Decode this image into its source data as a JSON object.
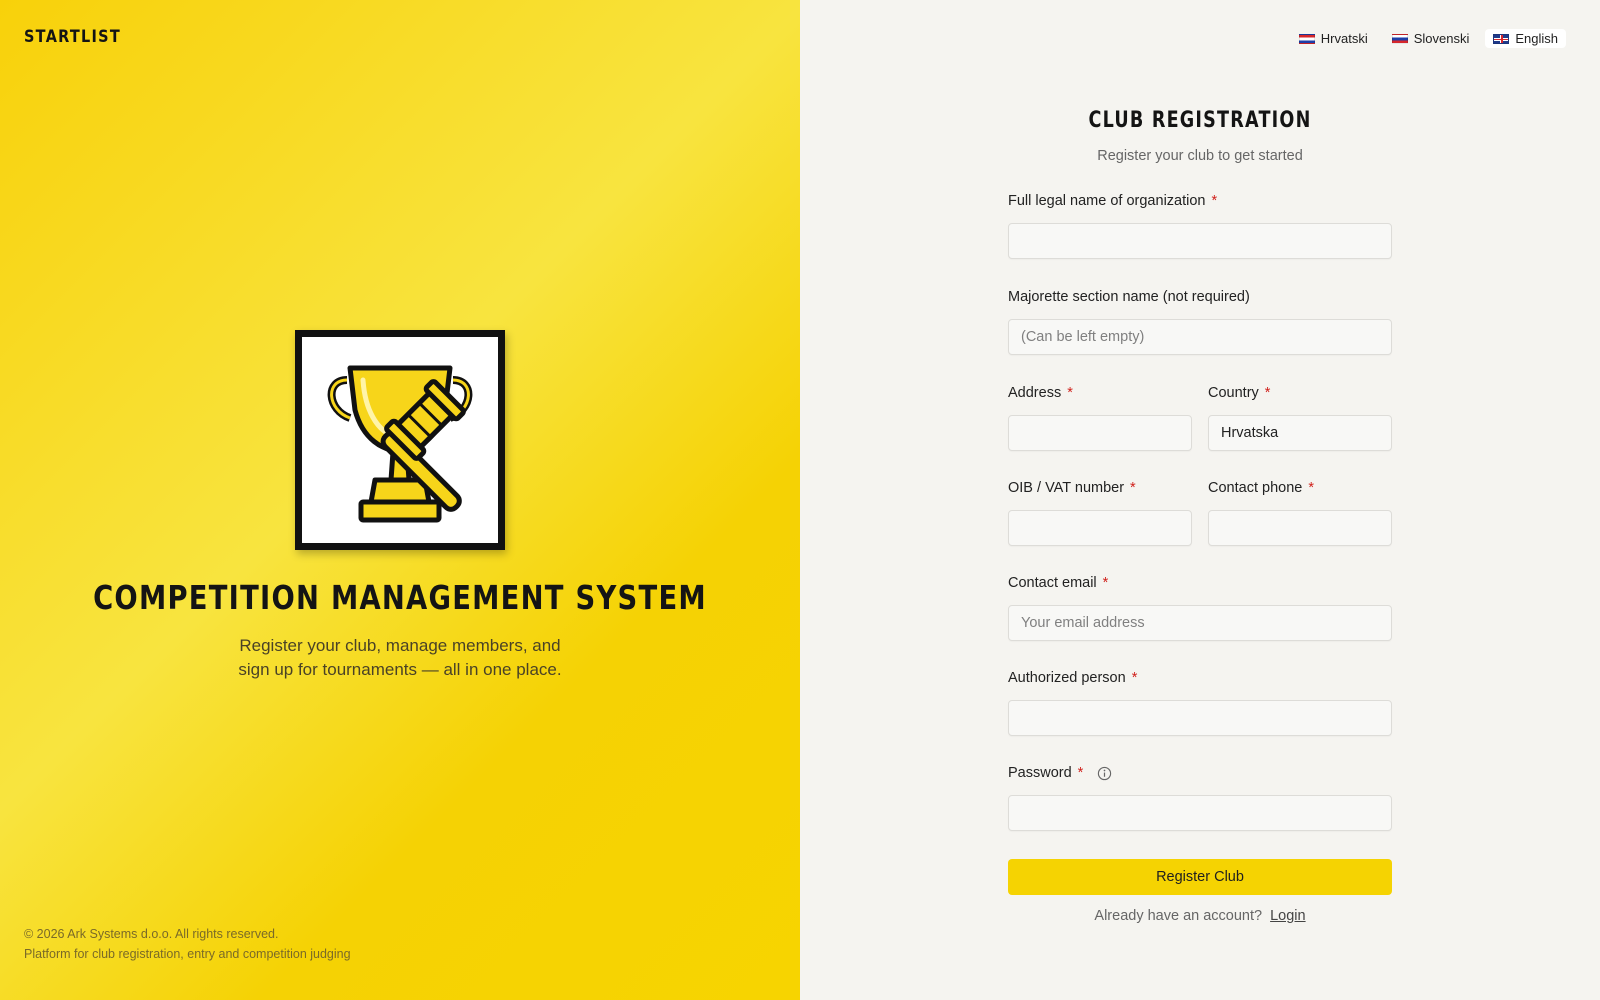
{
  "brand": "STARTLIST",
  "hero": {
    "title": "COMPETITION MANAGEMENT SYSTEM",
    "subtitle_line1": "Register your club, manage members, and",
    "subtitle_line2": "sign up for tournaments — all in one place."
  },
  "footer": {
    "copyright": "© 2026 Ark Systems d.o.o. All rights reserved.",
    "tagline": "Platform for club registration, entry and competition judging"
  },
  "languages": [
    {
      "label": "Hrvatski",
      "flag": "flag-hr-icon"
    },
    {
      "label": "Slovenski",
      "flag": "flag-si-icon"
    },
    {
      "label": "English",
      "flag": "flag-en-icon",
      "active": true
    }
  ],
  "form": {
    "title": "CLUB REGISTRATION",
    "subtitle": "Register your club to get started",
    "required_mark": "*",
    "fields": {
      "org_name": {
        "label": "Full legal name of organization",
        "value": "",
        "placeholder": ""
      },
      "section_name": {
        "label": "Majorette section name (not required)",
        "value": "",
        "placeholder": "(Can be left empty)"
      },
      "address": {
        "label": "Address",
        "value": "",
        "placeholder": ""
      },
      "country": {
        "label": "Country",
        "value": "Hrvatska",
        "placeholder": ""
      },
      "oib": {
        "label": "OIB / VAT number",
        "value": "",
        "placeholder": ""
      },
      "phone": {
        "label": "Contact phone",
        "value": "",
        "placeholder": ""
      },
      "email": {
        "label": "Contact email",
        "value": "",
        "placeholder": "Your email address"
      },
      "authorized": {
        "label": "Authorized person",
        "value": "",
        "placeholder": ""
      },
      "password": {
        "label": "Password",
        "value": "",
        "placeholder": ""
      }
    },
    "submit_label": "Register Club",
    "login_prompt": "Already have an account?",
    "login_link": "Login"
  },
  "colors": {
    "accent": "#f5d302",
    "required": "#d0201b",
    "right_bg": "#f5f4f0"
  }
}
